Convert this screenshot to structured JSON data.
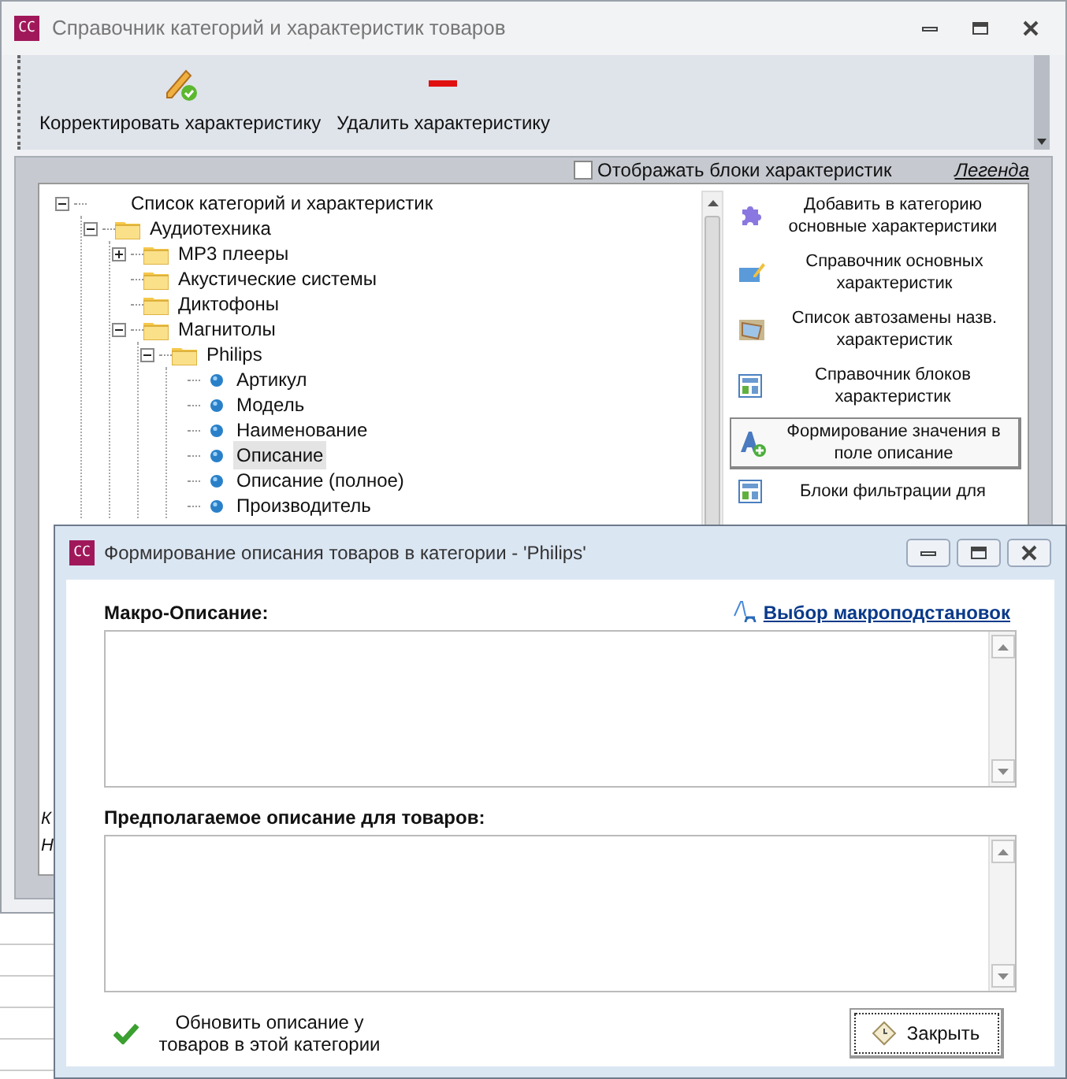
{
  "main_window": {
    "logo": "CC",
    "title": "Справочник категорий и характеристик товаров"
  },
  "toolbar": [
    {
      "kind": "edit",
      "label": "Корректировать характеристику"
    },
    {
      "kind": "delete",
      "label": "Удалить характеристику"
    }
  ],
  "show_blocks": {
    "label": "Отображать блоки характеристик",
    "checked": false
  },
  "legend_link": "Легенда",
  "tree": [
    {
      "label": "Список категорий и характеристик",
      "kind": "root",
      "expanded": true,
      "selected": false,
      "children": [
        {
          "label": "Аудиотехника",
          "kind": "folder",
          "expanded": true,
          "selected": false,
          "children": [
            {
              "label": "MP3 плееры",
              "kind": "folder",
              "expanded": false,
              "selected": false
            },
            {
              "label": "Акустические системы",
              "kind": "folder",
              "selected": false
            },
            {
              "label": "Диктофоны",
              "kind": "folder",
              "selected": false
            },
            {
              "label": "Магнитолы",
              "kind": "folder",
              "expanded": true,
              "selected": false,
              "children": [
                {
                  "label": "Philips",
                  "kind": "folder",
                  "expanded": true,
                  "selected": false,
                  "children": [
                    {
                      "label": "Артикул",
                      "kind": "field",
                      "selected": false
                    },
                    {
                      "label": "Модель",
                      "kind": "field",
                      "selected": false
                    },
                    {
                      "label": "Наименование",
                      "kind": "field",
                      "selected": false
                    },
                    {
                      "label": "Описание",
                      "kind": "field",
                      "selected": true
                    },
                    {
                      "label": "Описание (полное)",
                      "kind": "field",
                      "selected": false
                    },
                    {
                      "label": "Производитель",
                      "kind": "field",
                      "selected": false
                    }
                  ]
                }
              ]
            }
          ]
        }
      ]
    }
  ],
  "legend_fragments": [
    "К",
    "Н"
  ],
  "actions": [
    {
      "kind": "puzzle",
      "label": "Добавить в категорию основные характеристики",
      "focused": false
    },
    {
      "kind": "folder-edit",
      "label": "Справочник основных характеристик",
      "focused": false
    },
    {
      "kind": "book",
      "label": "Список автозамены назв. характеристик",
      "focused": false
    },
    {
      "kind": "blocks",
      "label": "Справочник блоков характеристик",
      "focused": false
    },
    {
      "kind": "font-add",
      "label": "Формирование значения в поле описание",
      "focused": true
    },
    {
      "kind": "blocks",
      "label": "Блоки фильтрации для",
      "focused": false
    }
  ],
  "dialog": {
    "logo": "CC",
    "title": "Формирование описания товаров в категории - 'Philips'",
    "macro_link": "Выбор макроподстановок",
    "macro_label": "Макро-Описание:",
    "preview_label": "Предполагаемое описание для товаров:",
    "update_button": "Обновить описание у товаров в этой категории",
    "close_button": "Закрыть"
  }
}
